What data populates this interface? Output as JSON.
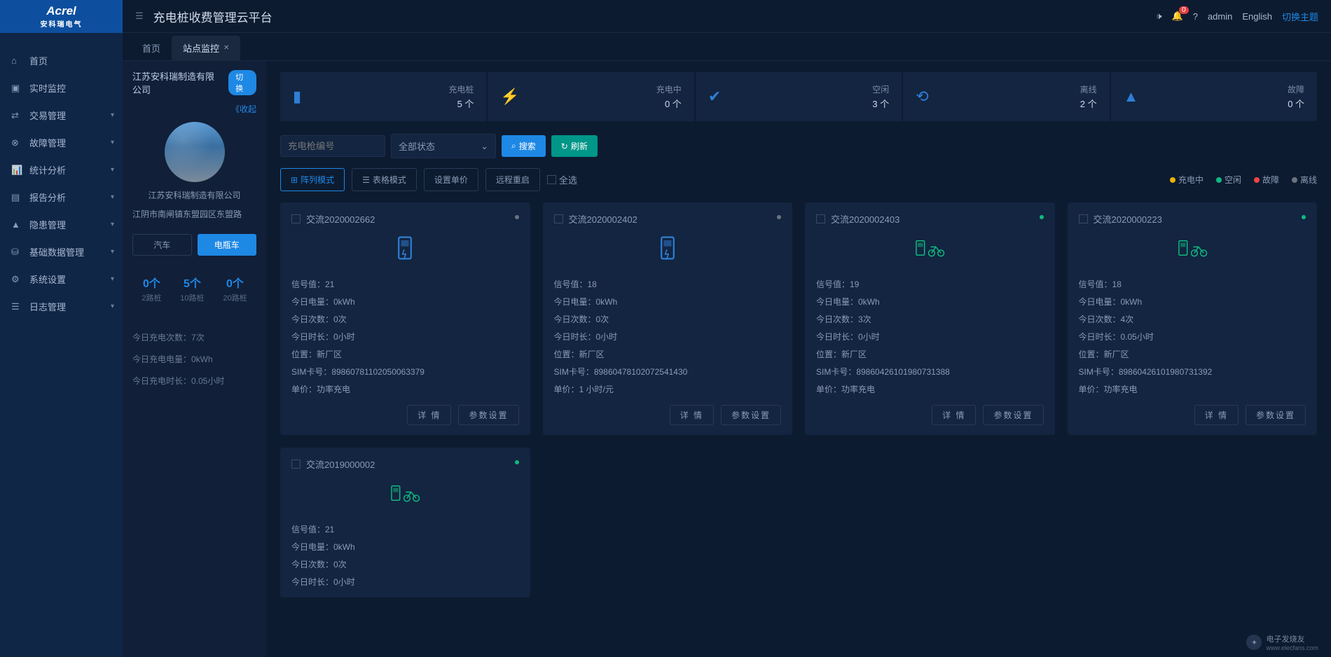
{
  "brand": {
    "name": "Acrel",
    "sub": "安科瑞电气"
  },
  "app_title": "充电桩收费管理云平台",
  "topbar": {
    "user": "admin",
    "lang": "English",
    "theme": "切换主题",
    "notif_count": "0"
  },
  "nav": [
    {
      "icon": "home",
      "label": "首页"
    },
    {
      "icon": "monitor",
      "label": "实时监控"
    },
    {
      "icon": "exchange",
      "label": "交易管理",
      "sub": true
    },
    {
      "icon": "fault",
      "label": "故障管理",
      "sub": true
    },
    {
      "icon": "chart",
      "label": "统计分析",
      "sub": true
    },
    {
      "icon": "report",
      "label": "报告分析",
      "sub": true
    },
    {
      "icon": "warning",
      "label": "隐患管理",
      "sub": true
    },
    {
      "icon": "data",
      "label": "基础数据管理",
      "sub": true
    },
    {
      "icon": "settings",
      "label": "系统设置",
      "sub": true
    },
    {
      "icon": "log",
      "label": "日志管理",
      "sub": true
    }
  ],
  "tabs": [
    {
      "label": "首页"
    },
    {
      "label": "站点监控",
      "active": true,
      "closable": true
    }
  ],
  "sidepanel": {
    "company": "江苏安科瑞制造有限公司",
    "switch": "切换",
    "collapse": "《收起",
    "sub_company": "江苏安科瑞制造有限公司",
    "address": "江阴市南闸镇东盟园区东盟路",
    "vehicle_tabs": [
      {
        "label": "汽车"
      },
      {
        "label": "电瓶车",
        "active": true
      }
    ],
    "routes": [
      {
        "num": "0个",
        "lbl": "2路桩"
      },
      {
        "num": "5个",
        "lbl": "10路桩"
      },
      {
        "num": "0个",
        "lbl": "20路桩"
      }
    ],
    "today": [
      "今日充电次数：7次",
      "今日充电电量：0kWh",
      "今日充电时长：0.05小时"
    ]
  },
  "stats": [
    {
      "icon": "pile",
      "color": "ic-blue",
      "label": "充电桩",
      "value": "5 个"
    },
    {
      "icon": "bolt",
      "color": "ic-blue",
      "label": "充电中",
      "value": "0 个"
    },
    {
      "icon": "check",
      "color": "ic-blue",
      "label": "空闲",
      "value": "3 个"
    },
    {
      "icon": "offline",
      "color": "ic-blue",
      "label": "离线",
      "value": "2 个"
    },
    {
      "icon": "alert",
      "color": "ic-blue",
      "label": "故障",
      "value": "0 个"
    }
  ],
  "filters": {
    "placeholder": "充电枪编号",
    "status_label": "全部状态",
    "search": "搜索",
    "refresh": "刷新"
  },
  "toolbar": {
    "grid_mode": "阵列模式",
    "table_mode": "表格模式",
    "set_price": "设置单价",
    "remote_restart": "远程重启",
    "select_all": "全选"
  },
  "legend": {
    "charging": "充电中",
    "idle": "空闲",
    "fault": "故障",
    "offline": "离线"
  },
  "device_labels": {
    "signal": "信号值：",
    "today_energy": "今日电量：",
    "today_count": "今日次数：",
    "today_duration": "今日时长：",
    "location": "位置：",
    "sim": "SIM卡号：",
    "price": "单价：",
    "detail_btn": "详 情",
    "param_btn": "参数设置"
  },
  "devices": [
    {
      "name": "交流2020002662",
      "status": "gray",
      "icon": "pile",
      "signal": "21",
      "energy": "0kWh",
      "count": "0次",
      "duration": "0小时",
      "location": "新厂区",
      "sim": "89860781102050063379",
      "price": "功率充电"
    },
    {
      "name": "交流2020002402",
      "status": "gray",
      "icon": "pile",
      "signal": "18",
      "energy": "0kWh",
      "count": "0次",
      "duration": "0小时",
      "location": "新厂区",
      "sim": "89860478102072541430",
      "price": "1 小时/元"
    },
    {
      "name": "交流2020002403",
      "status": "green",
      "icon": "bike",
      "signal": "19",
      "energy": "0kWh",
      "count": "3次",
      "duration": "0小时",
      "location": "新厂区",
      "sim": "89860426101980731388",
      "price": "功率充电"
    },
    {
      "name": "交流2020000223",
      "status": "green",
      "icon": "bike",
      "signal": "18",
      "energy": "0kWh",
      "count": "4次",
      "duration": "0.05小时",
      "location": "新厂区",
      "sim": "89860426101980731392",
      "price": "功率充电"
    },
    {
      "name": "交流2019000002",
      "status": "green",
      "icon": "bike",
      "signal": "21",
      "energy": "0kWh",
      "count": "0次",
      "duration": "0小时",
      "partial": true
    }
  ],
  "watermark": {
    "top": "电子发烧友",
    "bottom": "www.elecfans.com"
  }
}
